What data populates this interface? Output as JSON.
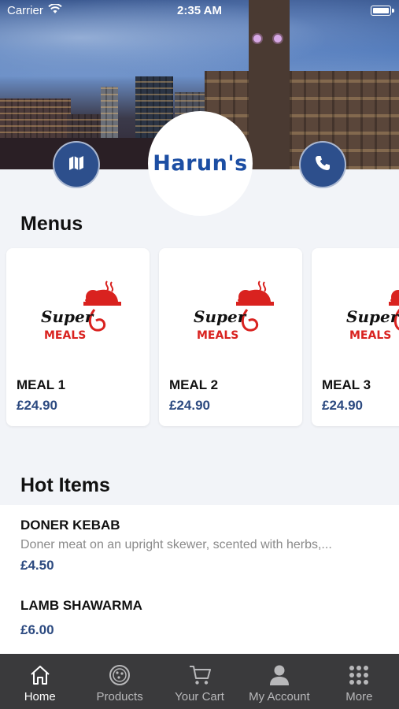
{
  "status_bar": {
    "carrier": "Carrier",
    "time": "2:35 AM"
  },
  "restaurant": {
    "logo_text": "Harun's"
  },
  "menus": {
    "title": "Menus",
    "logo_text": {
      "top": "Super",
      "bottom": "MEALS"
    },
    "items": [
      {
        "name": "MEAL 1",
        "price": "£24.90"
      },
      {
        "name": "MEAL 2",
        "price": "£24.90"
      },
      {
        "name": "MEAL 3",
        "price": "£24.90"
      }
    ]
  },
  "hot_items": {
    "title": "Hot Items",
    "items": [
      {
        "name": "DONER KEBAB",
        "description": "Doner meat on an upright skewer, scented with herbs,...",
        "price": "£4.50"
      },
      {
        "name": "LAMB SHAWARMA",
        "description": "",
        "price": "£6.00"
      }
    ]
  },
  "tab_bar": {
    "tabs": [
      {
        "label": "Home",
        "icon": "home-icon"
      },
      {
        "label": "Products",
        "icon": "pizza-icon"
      },
      {
        "label": "Your Cart",
        "icon": "cart-icon"
      },
      {
        "label": "My Account",
        "icon": "user-icon"
      },
      {
        "label": "More",
        "icon": "grid-icon"
      }
    ],
    "active_tab": "Home"
  },
  "colors": {
    "accent": "#2d4f8c",
    "price": "#2c4a80",
    "tabbar": "#3a3a3c",
    "logo_red": "#d9221f"
  }
}
